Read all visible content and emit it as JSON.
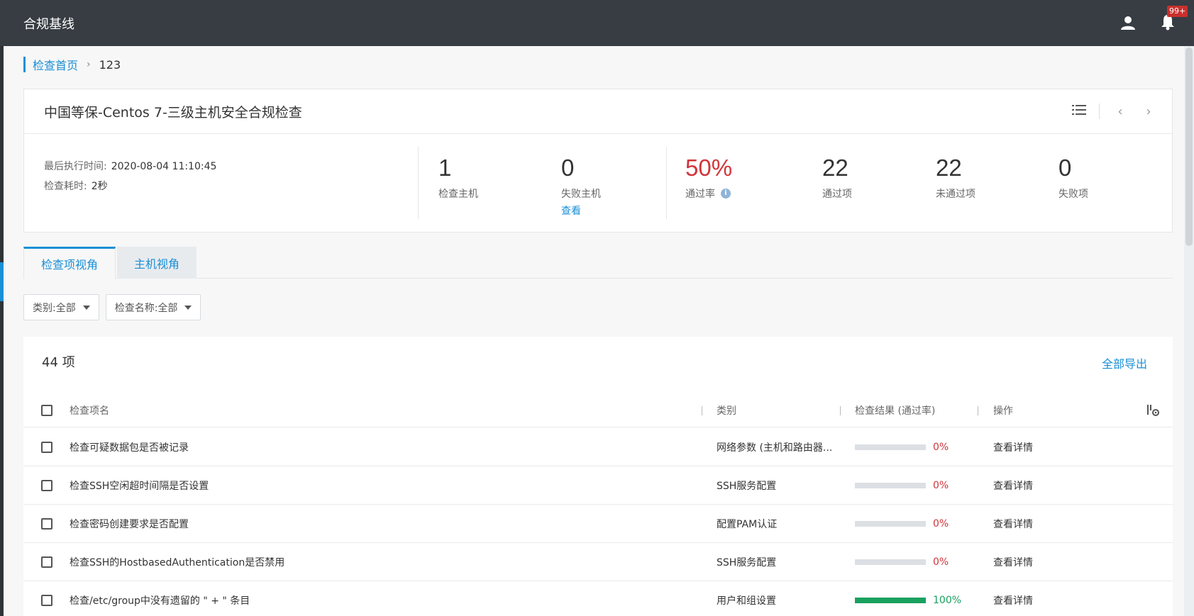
{
  "header": {
    "title": "合规基线",
    "notification_badge": "99+"
  },
  "breadcrumb": {
    "home": "检查首页",
    "current": "123"
  },
  "summary": {
    "title": "中国等保-Centos 7-三级主机安全合规检查",
    "last_run_label": "最后执行时间:",
    "last_run_value": "2020-08-04 11:10:45",
    "duration_label": "检查耗时:",
    "duration_value": "2秒",
    "stats": {
      "hosts": {
        "value": "1",
        "label": "检查主机"
      },
      "failed_hosts": {
        "value": "0",
        "label": "失败主机",
        "link": "查看"
      },
      "pass_rate": {
        "value": "50%",
        "label": "通过率"
      },
      "passed": {
        "value": "22",
        "label": "通过项"
      },
      "not_passed": {
        "value": "22",
        "label": "未通过项"
      },
      "failed": {
        "value": "0",
        "label": "失败项"
      }
    }
  },
  "tabs": [
    {
      "label": "检查项视角",
      "active": true
    },
    {
      "label": "主机视角",
      "active": false
    }
  ],
  "filters": {
    "category": "类别:全部",
    "check_name": "检查名称:全部"
  },
  "list": {
    "count": "44 项",
    "export": "全部导出",
    "columns": {
      "name": "检查项名",
      "category": "类别",
      "result": "检查结果 (通过率)",
      "action": "操作"
    },
    "rows": [
      {
        "name": "检查可疑数据包是否被记录",
        "category": "网络参数 (主机和路由器...",
        "percent": 0,
        "percent_label": "0%",
        "action": "查看详情"
      },
      {
        "name": "检查SSH空闲超时间隔是否设置",
        "category": "SSH服务配置",
        "percent": 0,
        "percent_label": "0%",
        "action": "查看详情"
      },
      {
        "name": "检查密码创建要求是否配置",
        "category": "配置PAM认证",
        "percent": 0,
        "percent_label": "0%",
        "action": "查看详情"
      },
      {
        "name": "检查SSH的HostbasedAuthentication是否禁用",
        "category": "SSH服务配置",
        "percent": 0,
        "percent_label": "0%",
        "action": "查看详情"
      },
      {
        "name": "检查/etc/group中没有遗留的 \" + \" 条目",
        "category": "用户和组设置",
        "percent": 100,
        "percent_label": "100%",
        "action": "查看详情"
      }
    ]
  },
  "colors": {
    "accent": "#1a8fd6",
    "fail": "#d0353b",
    "pass": "#19a15f",
    "header_bg": "#373d43"
  }
}
